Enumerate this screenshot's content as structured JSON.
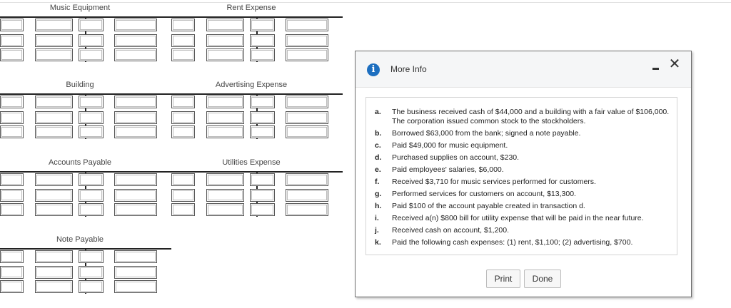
{
  "accounts": {
    "music_equipment": "Music Equipment",
    "rent_expense": "Rent Expense",
    "building": "Building",
    "advertising_expense": "Advertising Expense",
    "accounts_payable": "Accounts Payable",
    "utilities_expense": "Utilities Expense",
    "note_payable": "Note Payable"
  },
  "dialog": {
    "title": "More Info",
    "info_icon": "i",
    "close_icon": "✕",
    "items": [
      {
        "letter": "a.",
        "text": "The business received cash of $44,000 and a building with a fair value of $106,000. The corporation issued common stock to the stockholders."
      },
      {
        "letter": "b.",
        "text": "Borrowed $63,000 from the bank; signed a note payable."
      },
      {
        "letter": "c.",
        "text": "Paid $49,000 for music equipment."
      },
      {
        "letter": "d.",
        "text": "Purchased supplies on account, $230."
      },
      {
        "letter": "e.",
        "text": "Paid employees' salaries, $6,000."
      },
      {
        "letter": "f.",
        "text": "Received $3,710 for music services performed for customers."
      },
      {
        "letter": "g.",
        "text": "Performed services for customers on account, $13,300."
      },
      {
        "letter": "h.",
        "text": "Paid $100 of the account payable created in transaction d."
      },
      {
        "letter": "i.",
        "text": "Received a(n) $800 bill for utility expense that will be paid in the near future."
      },
      {
        "letter": "j.",
        "text": "Received cash on account, $1,200."
      },
      {
        "letter": "k.",
        "text": "Paid the following cash expenses: (1) rent, $1,100; (2) advertising, $700."
      }
    ],
    "print_label": "Print",
    "done_label": "Done"
  }
}
